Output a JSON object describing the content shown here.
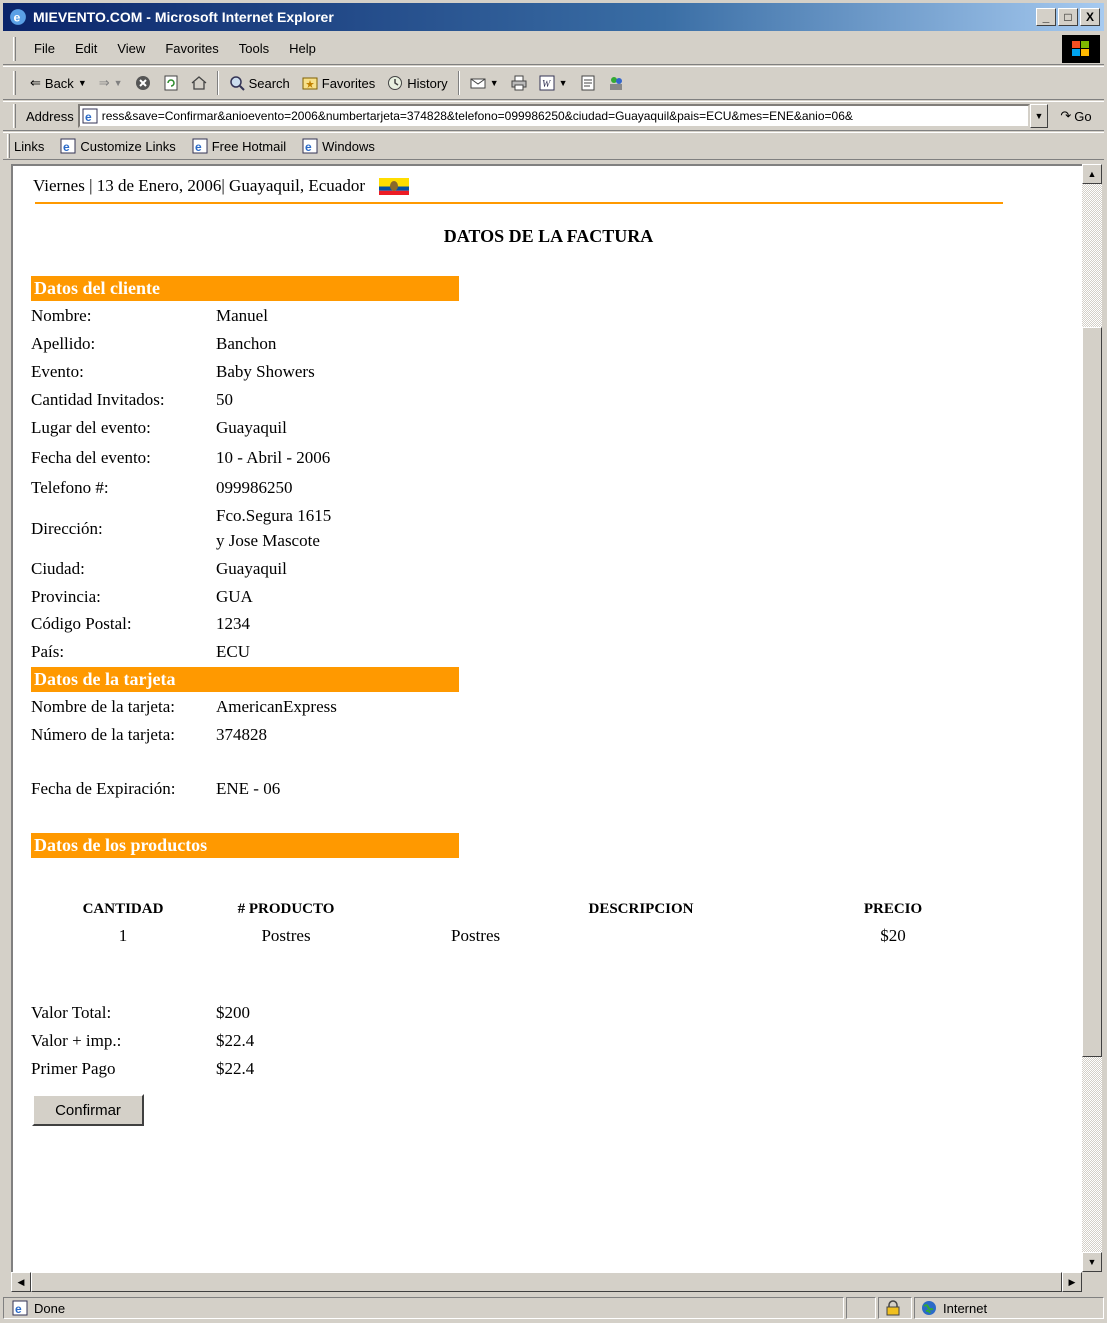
{
  "window": {
    "title": "MIEVENTO.COM - Microsoft Internet Explorer",
    "controls": [
      "_",
      "□",
      "X"
    ]
  },
  "menu": [
    "File",
    "Edit",
    "View",
    "Favorites",
    "Tools",
    "Help"
  ],
  "toolbar": {
    "back": "Back",
    "search": "Search",
    "favorites": "Favorites",
    "history": "History"
  },
  "address": {
    "label": "Address",
    "url": "ress&save=Confirmar&anioevento=2006&numbertarjeta=374828&telefono=099986250&ciudad=Guayaquil&pais=ECU&mes=ENE&anio=06&",
    "go": "Go"
  },
  "links": {
    "label": "Links",
    "items": [
      "Customize Links",
      "Free Hotmail",
      "Windows"
    ]
  },
  "page": {
    "dateline": "Viernes | 13 de Enero, 2006| Guayaquil, Ecuador",
    "heading": "DATOS DE LA FACTURA",
    "cliente": {
      "header": "Datos del cliente",
      "rows": [
        {
          "label": "Nombre:",
          "value": "Manuel"
        },
        {
          "label": "Apellido:",
          "value": "Banchon"
        },
        {
          "label": "Evento:",
          "value": "Baby Showers"
        },
        {
          "label": "Cantidad Invitados:",
          "value": "50"
        },
        {
          "label": "Lugar del evento:",
          "value": "Guayaquil"
        },
        {
          "label": "Fecha del evento:",
          "value": "10 - Abril - 2006"
        },
        {
          "label": "Telefono #:",
          "value": "099986250"
        },
        {
          "label": "Dirección:",
          "value": "Fco.Segura 1615",
          "value2": "y Jose Mascote"
        },
        {
          "label": "Ciudad:",
          "value": "Guayaquil"
        },
        {
          "label": "Provincia:",
          "value": "GUA"
        },
        {
          "label": "Código Postal:",
          "value": "1234"
        },
        {
          "label": "País:",
          "value": "ECU"
        }
      ]
    },
    "tarjeta": {
      "header": "Datos de la tarjeta",
      "rows": [
        {
          "label": "Nombre de la tarjeta:",
          "value": "AmericanExpress"
        },
        {
          "label": "Número de la tarjeta:",
          "value": "374828"
        },
        {
          "label": "Fecha de Expiración:",
          "value": "ENE - 06"
        }
      ]
    },
    "productos": {
      "header": "Datos de los productos",
      "columns": [
        "CANTIDAD",
        "# PRODUCTO",
        "DESCRIPCION",
        "PRECIO"
      ],
      "rows": [
        {
          "cantidad": "1",
          "producto": "Postres",
          "descripcion": "Postres",
          "precio": "$20"
        }
      ]
    },
    "totales": [
      {
        "label": "Valor Total:",
        "value": "$200"
      },
      {
        "label": "Valor + imp.:",
        "value": "$22.4"
      },
      {
        "label": "Primer Pago",
        "value": "$22.4"
      }
    ],
    "confirm_button": "Confirmar"
  },
  "status": {
    "text": "Done",
    "zone": "Internet"
  },
  "colors": {
    "accent_orange": "#ff9900",
    "title_bar": "#0a246a",
    "chrome": "#d4d0c8"
  }
}
